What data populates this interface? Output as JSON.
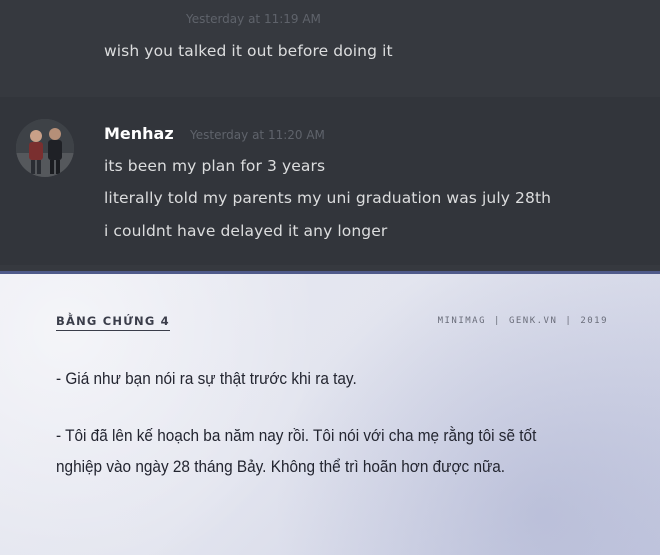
{
  "chat": {
    "prev_message": {
      "timestamp": "Yesterday at 11:19 AM",
      "lines": [
        "wish you talked it out before doing it"
      ]
    },
    "message": {
      "username": "Menhaz",
      "timestamp": "Yesterday at 11:20 AM",
      "lines": [
        "its been my plan for 3 years",
        "literally told my parents my uni graduation was july 28th",
        "i couldnt have delayed it any longer"
      ]
    }
  },
  "card": {
    "tag": "BẰNG CHỨNG 4",
    "meta": [
      "MINIMAG",
      "GENK.VN",
      "2019"
    ],
    "meta_separator": "|",
    "paragraphs": [
      "- Giá như bạn nói ra sự thật trước khi ra tay.",
      "- Tôi đã lên kế hoạch ba năm nay rồi. Tôi nói với cha mẹ rằng tôi sẽ tốt nghiệp vào ngày 28 tháng Bảy. Không thể trì hoãn hơn được nữa."
    ]
  },
  "colors": {
    "chat_bg": "#36393f",
    "chat_text": "#dcddde",
    "username": "#ffffff",
    "timestamp": "#5f636b",
    "card_border": "#4f5a8a",
    "card_text": "#232530"
  }
}
